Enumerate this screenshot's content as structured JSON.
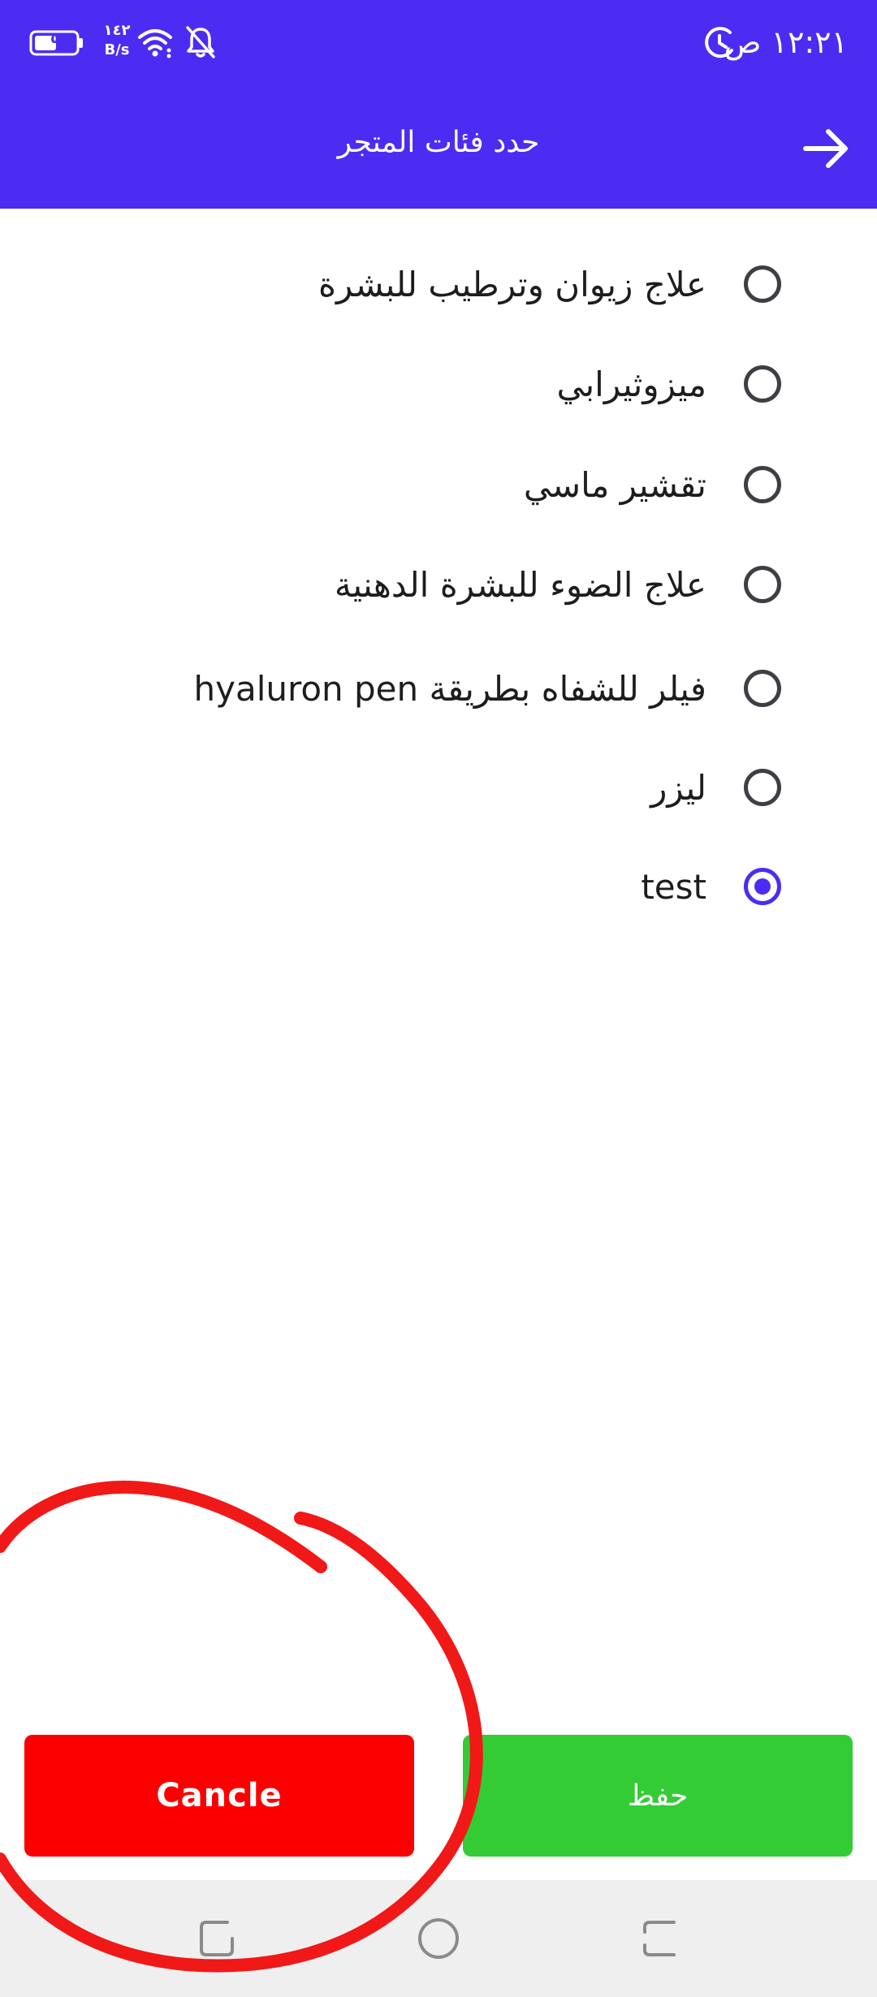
{
  "status_bar": {
    "time": "١٢:٢١ ص",
    "net_speed_value": "١٤٢",
    "net_speed_unit": "B/s",
    "battery_level": "٥١",
    "icons": [
      "alarm-icon",
      "bell-off-icon",
      "wifi-icon",
      "battery-icon"
    ]
  },
  "header": {
    "title": "حدد فئات المتجر",
    "back_icon": "arrow-right-icon",
    "background": "#4c2cf2"
  },
  "options": [
    {
      "label": "علاج زيوان وترطيب للبشرة",
      "selected": false
    },
    {
      "label": "ميزوثيرابي",
      "selected": false
    },
    {
      "label": "تقشير ماسي",
      "selected": false
    },
    {
      "label": "علاج الضوء للبشرة الدهنية",
      "selected": false
    },
    {
      "label": "فيلر للشفاه بطريقة hyaluron pen",
      "selected": false
    },
    {
      "label": "ليزر",
      "selected": false
    },
    {
      "label": "test",
      "selected": true
    }
  ],
  "buttons": {
    "cancel_label": "Cancle",
    "save_label": "حفظ",
    "cancel_color": "#fc0000",
    "save_color": "#33cc35"
  },
  "nav_bar": {
    "icons": [
      "recents-icon",
      "home-icon",
      "back-gesture-icon"
    ]
  }
}
